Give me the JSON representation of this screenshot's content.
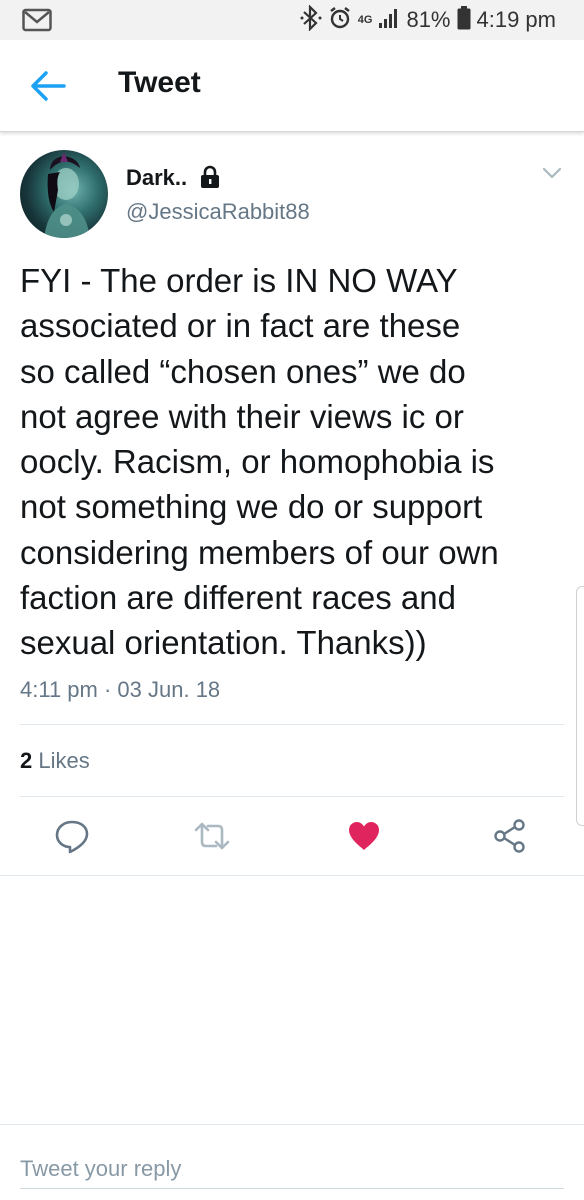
{
  "status_bar": {
    "network": "4G",
    "battery": "81%",
    "time": "4:19 pm"
  },
  "header": {
    "title": "Tweet"
  },
  "tweet": {
    "author_name": "Dark..",
    "author_handle": "@JessicaRabbit88",
    "text_lines": [
      "FYI - The order is IN NO WAY",
      "associated or in fact are these",
      "so called “chosen ones” we do",
      "not agree with their views ic or",
      "oocly. Racism, or homophobia is",
      "not something we do or support",
      "considering members of our own",
      "faction are different races and",
      "sexual orientation. Thanks))"
    ],
    "timestamp": "4:11 pm · 03 Jun. 18",
    "likes_count": "2",
    "likes_label": "Likes",
    "liked": true
  },
  "colors": {
    "accent": "#1da1f2",
    "like": "#e0245e",
    "muted": "#657786",
    "icon_gray": "#657786",
    "retweet_disabled": "#aab8c2"
  },
  "icons": {
    "back": "arrow-left-icon",
    "lock": "lock-icon",
    "caret": "chevron-down-icon",
    "reply": "reply-icon",
    "retweet": "retweet-icon",
    "like": "heart-icon",
    "share": "share-icon"
  },
  "reply": {
    "placeholder": "Tweet your reply"
  }
}
